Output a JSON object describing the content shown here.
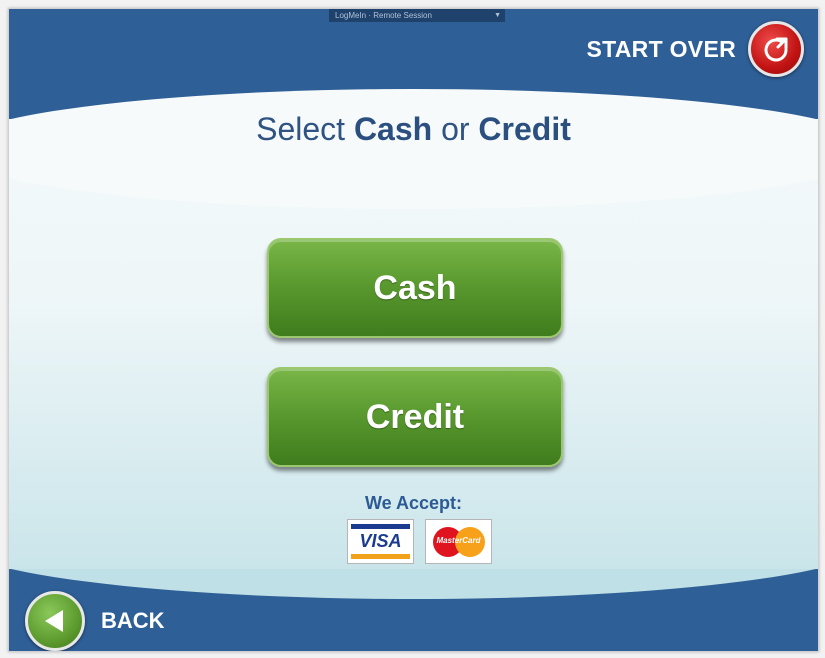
{
  "overlay": {
    "label": "LogMeIn · Remote Session"
  },
  "header": {
    "start_over_label": "START OVER",
    "start_over_icon": "restart-arrow-icon"
  },
  "headline": {
    "prefix": "Select ",
    "option_a": "Cash",
    "middle": " or ",
    "option_b": "Credit"
  },
  "options": {
    "cash_label": "Cash",
    "credit_label": "Credit"
  },
  "accept": {
    "label": "We Accept:",
    "cards": [
      {
        "name": "VISA",
        "icon": "visa-logo-icon"
      },
      {
        "name": "MasterCard",
        "icon": "mastercard-logo-icon"
      }
    ]
  },
  "footer": {
    "back_label": "BACK",
    "back_icon": "back-arrow-icon"
  },
  "colors": {
    "brand_blue": "#2f5f97",
    "button_green": "#5a9a2f",
    "start_over_red": "#c21313"
  }
}
